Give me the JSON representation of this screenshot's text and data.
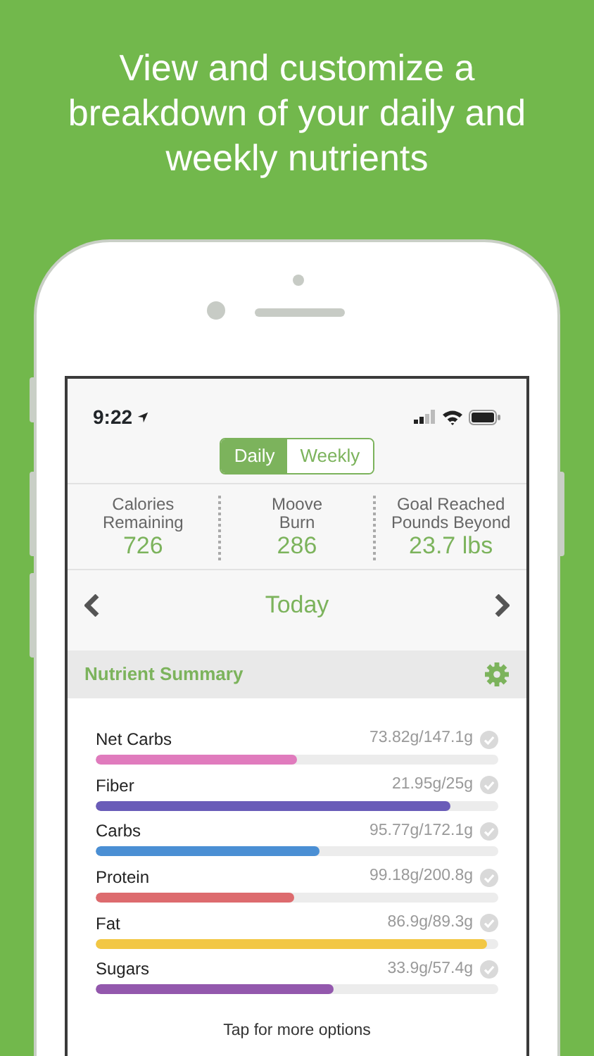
{
  "headline": "View and customize a breakdown of your daily and weekly nutrients",
  "status_bar": {
    "time": "9:22"
  },
  "segments": [
    {
      "label": "Daily",
      "selected": true
    },
    {
      "label": "Weekly",
      "selected": false
    }
  ],
  "stats": [
    {
      "label": [
        "Calories",
        "Remaining"
      ],
      "value": "726"
    },
    {
      "label": [
        "Moove",
        "Burn"
      ],
      "value": "286"
    },
    {
      "label": [
        "Goal Reached",
        "Pounds Beyond"
      ],
      "value": "23.7 lbs"
    }
  ],
  "date_nav": {
    "title": "Today"
  },
  "section": {
    "title": "Nutrient Summary"
  },
  "nutrients": [
    {
      "name": "Net Carbs",
      "reading": "73.82g/147.1g",
      "level": 0.5,
      "color": "#e07bbd"
    },
    {
      "name": "Fiber",
      "reading": "21.95g/25g",
      "level": 0.88,
      "color": "#6a5cb8"
    },
    {
      "name": "Carbs",
      "reading": "95.77g/172.1g",
      "level": 0.557,
      "color": "#4a8fd4"
    },
    {
      "name": "Protein",
      "reading": "99.18g/200.8g",
      "level": 0.493,
      "color": "#dd6b6e"
    },
    {
      "name": "Fat",
      "reading": "86.9g/89.3g",
      "level": 0.973,
      "color": "#f2c744"
    },
    {
      "name": "Sugars",
      "reading": "33.9g/57.4g",
      "level": 0.59,
      "color": "#9358ad"
    }
  ],
  "footer_link": "Tap for more options"
}
